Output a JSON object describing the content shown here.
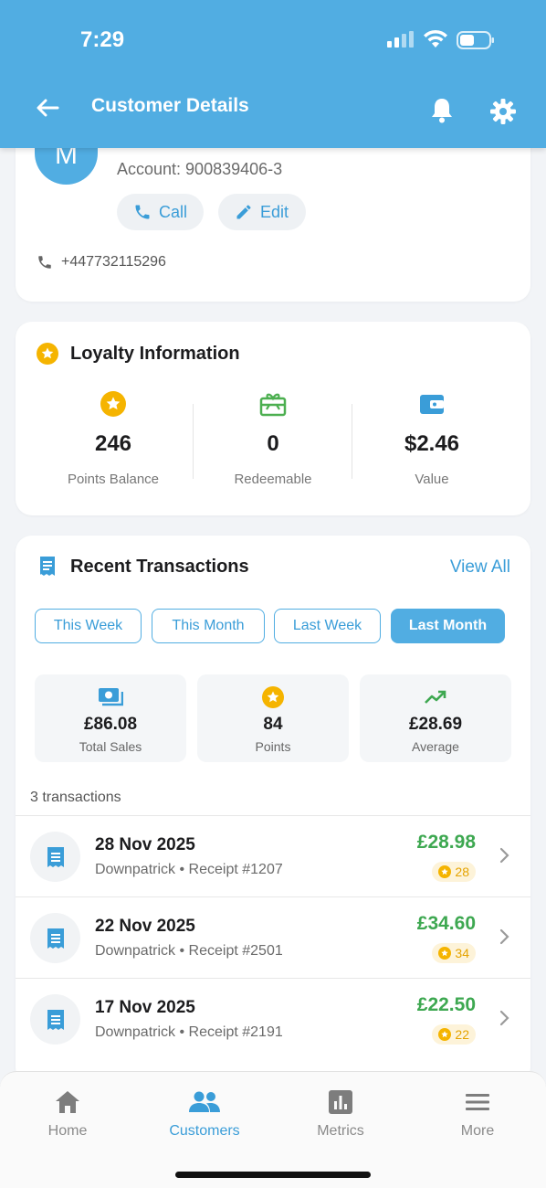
{
  "status_bar": {
    "time": "7:29"
  },
  "header": {
    "title": "Customer Details"
  },
  "customer": {
    "avatar_initial": "M",
    "account": "Account: 900839406-3",
    "call_label": "Call",
    "edit_label": "Edit",
    "phone": "+447732115296"
  },
  "loyalty": {
    "title": "Loyalty Information",
    "items": [
      {
        "value": "246",
        "label": "Points Balance",
        "icon": "star-circle-icon",
        "color": "#f5b400"
      },
      {
        "value": "0",
        "label": "Redeemable",
        "icon": "gift-card-icon",
        "color": "#4caf50"
      },
      {
        "value": "$2.46",
        "label": "Value",
        "icon": "wallet-icon",
        "color": "#3a9dd8"
      }
    ]
  },
  "transactions": {
    "title": "Recent Transactions",
    "view_all": "View All",
    "filters": [
      "This Week",
      "This Month",
      "Last Week",
      "Last Month"
    ],
    "active_filter": "Last Month",
    "stats": [
      {
        "value": "£86.08",
        "label": "Total Sales",
        "icon": "cash-icon"
      },
      {
        "value": "84",
        "label": "Points",
        "icon": "star-circle-icon"
      },
      {
        "value": "£28.69",
        "label": "Average",
        "icon": "trending-up-icon"
      }
    ],
    "count_text": "3 transactions",
    "rows": [
      {
        "date": "28 Nov 2025",
        "location": "Downpatrick",
        "receipt": "Receipt #1207",
        "amount": "£28.98",
        "points": "28"
      },
      {
        "date": "22 Nov 2025",
        "location": "Downpatrick",
        "receipt": "Receipt #2501",
        "amount": "£34.60",
        "points": "34"
      },
      {
        "date": "17 Nov 2025",
        "location": "Downpatrick",
        "receipt": "Receipt #2191",
        "amount": "£22.50",
        "points": "22"
      }
    ],
    "separator": "•"
  },
  "bottom_nav": {
    "items": [
      {
        "label": "Home",
        "icon": "home-icon"
      },
      {
        "label": "Customers",
        "icon": "customers-icon"
      },
      {
        "label": "Metrics",
        "icon": "metrics-icon"
      },
      {
        "label": "More",
        "icon": "menu-icon"
      }
    ],
    "active": "Customers"
  },
  "colors": {
    "primary": "#51ade2",
    "accent_text": "#3a9dd8",
    "amount_green": "#3ea851",
    "points_gold": "#f5b400"
  }
}
